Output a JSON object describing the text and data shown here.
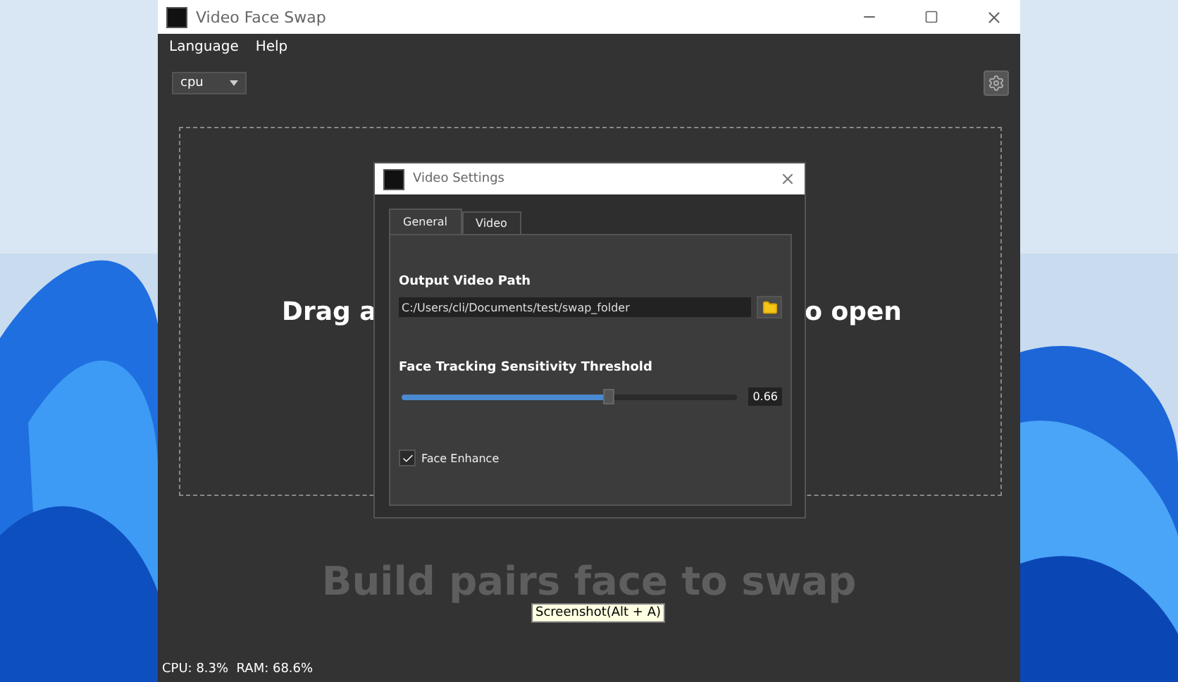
{
  "window": {
    "title": "Video Face Swap"
  },
  "menu": [
    "Language",
    "Help"
  ],
  "device_select": {
    "value": "cpu"
  },
  "drop_zone": {
    "text_left": "Drag a",
    "text_right": "o open"
  },
  "pairs_hint": "Build pairs face to swap",
  "tooltip": "Screenshot(Alt + A)",
  "status_bar": "CPU: 8.3%  RAM: 68.6%",
  "dialog": {
    "title": "Video Settings",
    "tabs": [
      {
        "label": "General",
        "selected": true
      },
      {
        "label": "Video",
        "selected": false
      }
    ],
    "output_label": "Output Video Path",
    "output_path": "C:/Users/cli/Documents/test/swap_folder",
    "threshold_label": "Face Tracking Sensitivity Threshold",
    "threshold": {
      "level": 0.61,
      "reading": "0.66"
    },
    "face_enhance": {
      "label": "Face Enhance",
      "checked": true
    }
  }
}
